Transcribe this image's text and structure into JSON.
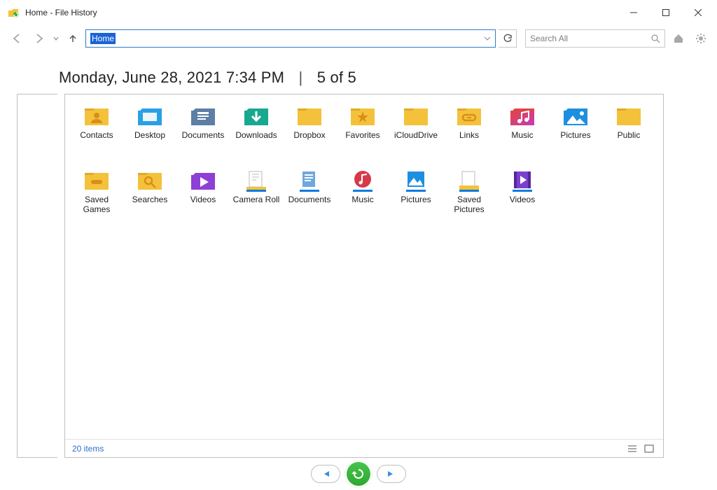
{
  "window": {
    "title": "Home - File History"
  },
  "toolbar": {
    "address_value": "Home",
    "search_placeholder": "Search All"
  },
  "header": {
    "date": "Monday, June 28, 2021 7:34 PM",
    "page_text": "5 of 5"
  },
  "items": [
    {
      "label": "Contacts",
      "icon": "folder-person"
    },
    {
      "label": "Desktop",
      "icon": "folder-desktop"
    },
    {
      "label": "Documents",
      "icon": "folder-docs"
    },
    {
      "label": "Downloads",
      "icon": "folder-down"
    },
    {
      "label": "Dropbox",
      "icon": "folder"
    },
    {
      "label": "Favorites",
      "icon": "folder-star"
    },
    {
      "label": "iCloudDrive",
      "icon": "folder"
    },
    {
      "label": "Links",
      "icon": "folder-link"
    },
    {
      "label": "Music",
      "icon": "folder-music"
    },
    {
      "label": "Pictures",
      "icon": "folder-pic"
    },
    {
      "label": "Public",
      "icon": "folder"
    },
    {
      "label": "Saved Games",
      "icon": "folder-game"
    },
    {
      "label": "Searches",
      "icon": "folder-search"
    },
    {
      "label": "Videos",
      "icon": "folder-video"
    },
    {
      "label": "Camera Roll",
      "icon": "lib-camera"
    },
    {
      "label": "Documents",
      "icon": "lib-docs"
    },
    {
      "label": "Music",
      "icon": "lib-music"
    },
    {
      "label": "Pictures",
      "icon": "lib-pic"
    },
    {
      "label": "Saved Pictures",
      "icon": "lib-saved"
    },
    {
      "label": "Videos",
      "icon": "lib-video"
    }
  ],
  "status": {
    "count_text": "20 items"
  },
  "colors": {
    "accent": "#1a63d6",
    "folder": "#f4c23a",
    "folderTab": "#e0a928",
    "libBar": "#0f7be0",
    "green": "#35b339"
  }
}
